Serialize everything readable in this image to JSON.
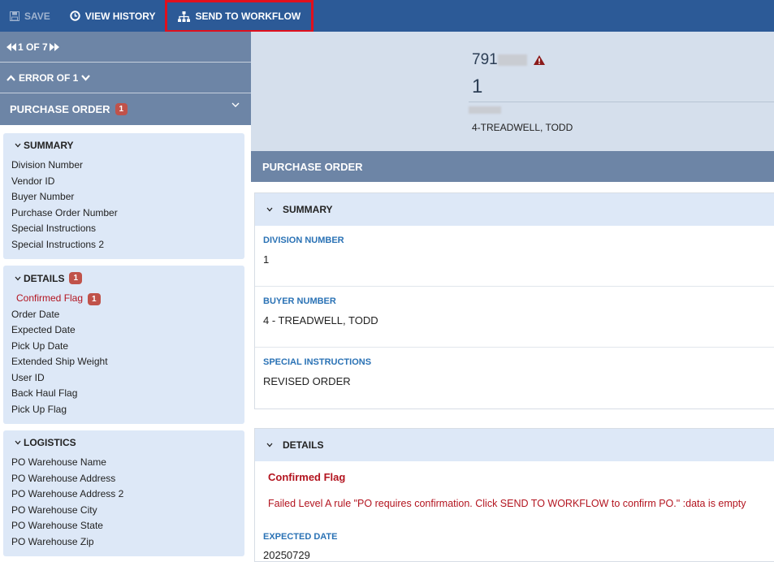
{
  "toolbar": {
    "save_label": "SAVE",
    "history_label": "VIEW HISTORY",
    "workflow_label": "SEND TO WORKFLOW"
  },
  "nav": {
    "pager": "1 OF 7",
    "error_nav": "ERROR OF 1"
  },
  "left_section": {
    "title": "PURCHASE ORDER",
    "badge": "1"
  },
  "cards": {
    "summary": {
      "title": "SUMMARY",
      "items": [
        "Division Number",
        "Vendor ID",
        "Buyer Number",
        "Purchase Order Number",
        "Special Instructions",
        "Special Instructions 2"
      ]
    },
    "details": {
      "title": "DETAILS",
      "badge": "1",
      "error_item": "Confirmed Flag",
      "error_badge": "1",
      "items": [
        "Order Date",
        "Expected Date",
        "Pick Up Date",
        "Extended Ship Weight",
        "User ID",
        "Back Haul Flag",
        "Pick Up Flag"
      ]
    },
    "logistics": {
      "title": "LOGISTICS",
      "items": [
        "PO Warehouse Name",
        "PO Warehouse Address",
        "PO Warehouse Address 2",
        "PO Warehouse City",
        "PO Warehouse State",
        "PO Warehouse Zip"
      ]
    }
  },
  "header": {
    "doc_number": "791",
    "line2": "1",
    "buyer": "4-TREADWELL, TODD"
  },
  "main": {
    "section_title": "PURCHASE ORDER",
    "summary_panel": {
      "title": "SUMMARY",
      "fields": [
        {
          "label": "DIVISION NUMBER",
          "value": "1"
        },
        {
          "label": "BUYER NUMBER",
          "value": "4 - TREADWELL, TODD"
        },
        {
          "label": "SPECIAL INSTRUCTIONS",
          "value": "REVISED ORDER"
        }
      ]
    },
    "details_panel": {
      "title": "DETAILS",
      "error_title": "Confirmed Flag",
      "error_message": "Failed Level A rule \"PO requires confirmation. Click SEND TO WORKFLOW to confirm PO.\" :data is empty",
      "expected_label": "EXPECTED DATE",
      "expected_value": "20250729"
    }
  },
  "colors": {
    "toolbar_bg": "#2c5a97",
    "nav_bg": "#6d85a6",
    "card_bg": "#dde8f7",
    "error": "#b3141f",
    "label_blue": "#2a72b5",
    "highlight": "#e0101d"
  }
}
